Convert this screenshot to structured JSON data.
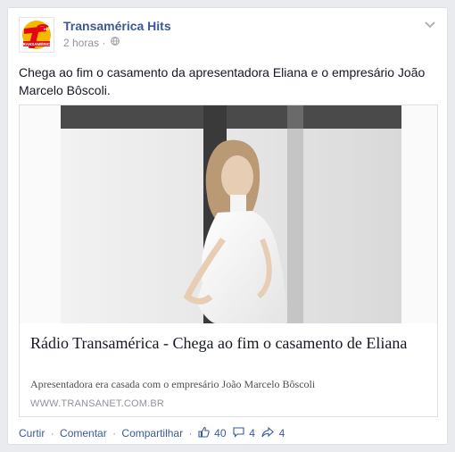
{
  "header": {
    "page_name": "Transamérica Hits",
    "timestamp": "2 horas",
    "separator": "·",
    "logo_text": "Transamérica",
    "logo_sub": "HITS"
  },
  "post": {
    "text": "Chega ao fim o casamento da apresentadora Eliana e o empresário João Marcelo Bôscoli."
  },
  "link_preview": {
    "title": "Rádio Transamérica - Chega ao fim o casamento de Eliana",
    "description": "Apresentadora era casada com o empresário João Marcelo Bôscoli",
    "domain": "WWW.TRANSANET.COM.BR"
  },
  "actions": {
    "like": "Curtir",
    "comment": "Comentar",
    "share": "Compartilhar",
    "separator": "·",
    "likes_count": "40",
    "comments_count": "4",
    "shares_count": "4"
  },
  "colors": {
    "link_blue": "#3b5998",
    "logo_red": "#e30613",
    "logo_yellow": "#f5b800"
  },
  "icons": [
    "globe-icon",
    "chevron-down-icon",
    "thumbs-up-icon",
    "comment-icon",
    "share-icon"
  ]
}
